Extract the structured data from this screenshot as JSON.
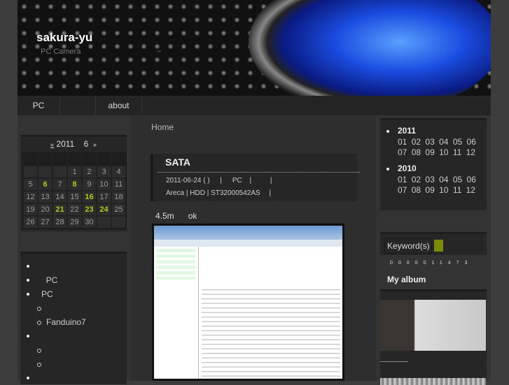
{
  "header": {
    "title": "sakura-yu",
    "subtitle": "PC Camera",
    "arrow": "→"
  },
  "nav": {
    "items": [
      {
        "label": "PC"
      },
      {
        "label": ""
      },
      {
        "label": "about"
      }
    ]
  },
  "calendar": {
    "prev": "«",
    "year": "2011",
    "month": "6",
    "next": "»",
    "days": [
      "",
      "",
      "",
      "1",
      "2",
      "3",
      "4",
      "5",
      "6",
      "7",
      "8",
      "9",
      "10",
      "11",
      "12",
      "13",
      "14",
      "15",
      "16",
      "17",
      "18",
      "19",
      "20",
      "21",
      "22",
      "23",
      "24",
      "25",
      "26",
      "27",
      "28",
      "29",
      "30",
      "",
      ""
    ],
    "highlighted": [
      "6",
      "8",
      "16",
      "21",
      "23",
      "24"
    ]
  },
  "categories": {
    "items": [
      {
        "label": "",
        "level": 1
      },
      {
        "label": "  PC",
        "level": 1
      },
      {
        "label": "PC",
        "level": 1
      },
      {
        "label": "",
        "level": 2
      },
      {
        "label": "Fanduino7",
        "level": 2
      },
      {
        "label": "",
        "level": 1
      },
      {
        "label": "",
        "level": 2
      },
      {
        "label": "",
        "level": 2
      },
      {
        "label": "",
        "level": 1
      }
    ]
  },
  "breadcrumb": "Home",
  "post": {
    "title": "SATA",
    "date": "2011-06-24 ( )",
    "category": "PC",
    "sep": "|",
    "tags": "Areca | HDD | ST32000542AS",
    "body_a": "4.5m",
    "body_b": "ok"
  },
  "archive": [
    {
      "year": "2011",
      "months": [
        "01",
        "02",
        "03",
        "04",
        "05",
        "06",
        "07",
        "08",
        "09",
        "10",
        "11",
        "12"
      ]
    },
    {
      "year": "2010",
      "months": [
        "01",
        "02",
        "03",
        "04",
        "05",
        "06",
        "07",
        "08",
        "09",
        "10",
        "11",
        "12"
      ]
    }
  ],
  "search": {
    "placeholder": "Keyword(s)",
    "button_color": "#7a8a0a"
  },
  "counter": "0000011473",
  "album": {
    "title": "My album"
  },
  "colors": {
    "highlight": "#b5c722",
    "accent_blue": "#1a4ce0"
  }
}
